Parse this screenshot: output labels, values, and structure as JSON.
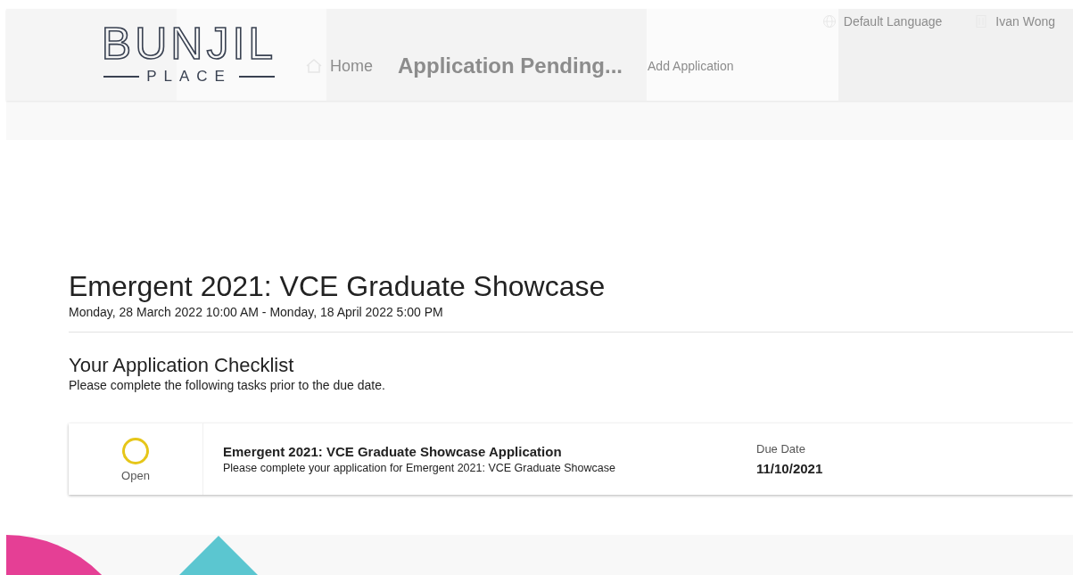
{
  "header": {
    "logo": {
      "name": "BUNJIL",
      "tagline": "PLACE"
    },
    "topbar": {
      "language": "Default Language",
      "user": "Ivan Wong"
    },
    "nav": [
      {
        "label": "Home",
        "kind": "home"
      },
      {
        "label": "Application Pending...",
        "kind": "title"
      },
      {
        "label": "Add Application",
        "kind": "link"
      }
    ]
  },
  "event": {
    "title": "Emergent 2021: VCE Graduate Showcase",
    "dates": "Monday, 28 March 2022 10:00 AM - Monday, 18 April 2022 5:00 PM"
  },
  "checklist": {
    "title": "Your Application Checklist",
    "subtitle": "Please complete the following tasks prior to the due date.",
    "tasks": [
      {
        "status": "Open",
        "color": "#e6c619",
        "title": "Emergent 2021: VCE Graduate Showcase Application",
        "description": "Please complete your application for Emergent 2021: VCE Graduate Showcase",
        "due_label": "Due Date",
        "due_date": "11/10/2021"
      }
    ]
  }
}
